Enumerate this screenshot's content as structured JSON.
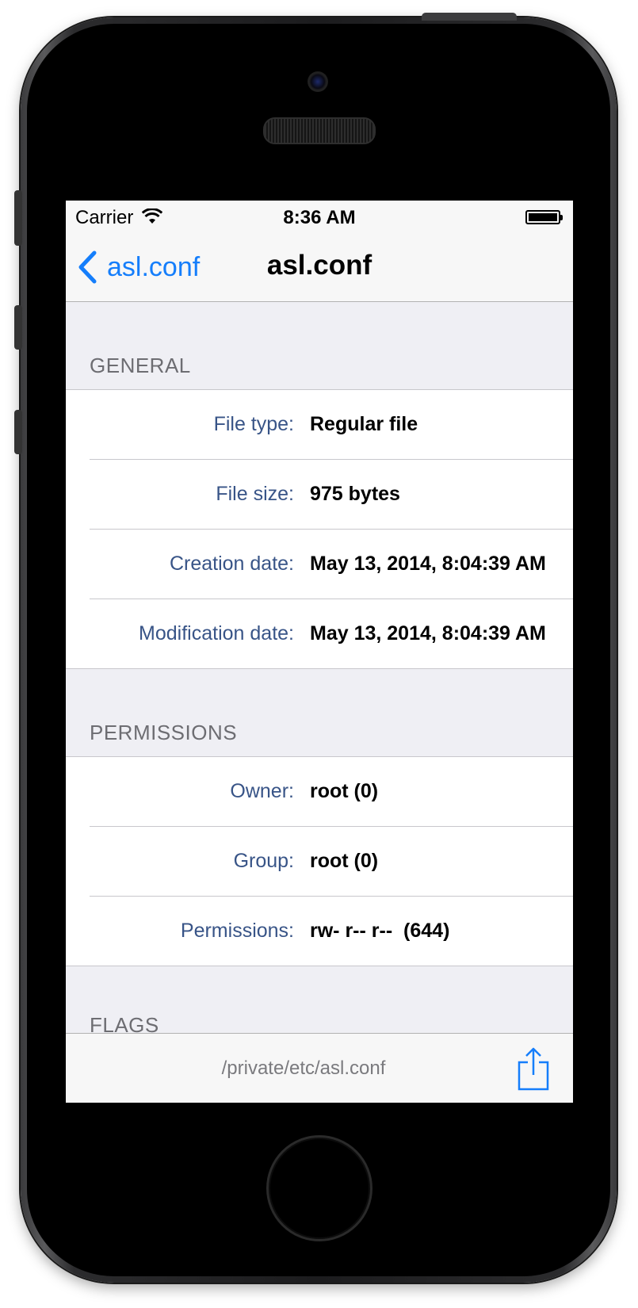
{
  "status_bar": {
    "carrier": "Carrier",
    "time": "8:36 AM"
  },
  "nav_bar": {
    "back_label": "asl.conf",
    "title": "asl.conf"
  },
  "colors": {
    "tint": "#157efb",
    "row_label": "#385487",
    "section_header": "#6d6d72"
  },
  "sections": {
    "general": {
      "header": "GENERAL",
      "rows": [
        {
          "label": "File type:",
          "value": "Regular file"
        },
        {
          "label": "File size:",
          "value": "975 bytes"
        },
        {
          "label": "Creation date:",
          "value": "May 13, 2014, 8:04:39 AM"
        },
        {
          "label": "Modification date:",
          "value": "May 13, 2014, 8:04:39 AM"
        }
      ]
    },
    "permissions": {
      "header": "PERMISSIONS",
      "rows": [
        {
          "label": "Owner:",
          "value": "root (0)"
        },
        {
          "label": "Group:",
          "value": "root (0)"
        },
        {
          "label": "Permissions:",
          "value": "rw- r-- r--  (644)"
        }
      ]
    },
    "flags": {
      "header": "FLAGS"
    }
  },
  "toolbar": {
    "path": "/private/etc/asl.conf",
    "share_icon": "share-icon"
  }
}
